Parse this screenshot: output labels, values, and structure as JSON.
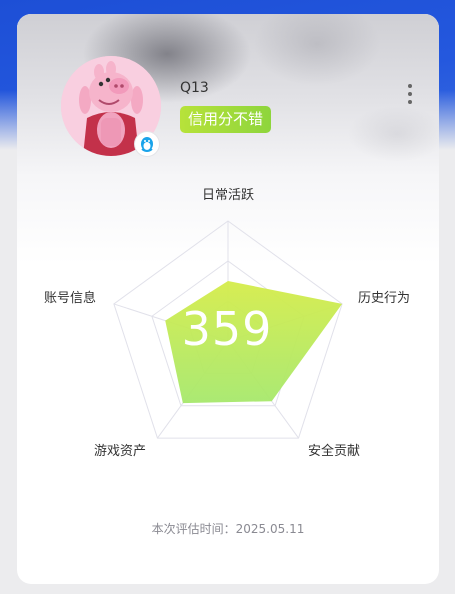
{
  "profile": {
    "username": "Q13",
    "credit_tag": "信用分不错",
    "avatar_icon": "peppa-pig-avatar",
    "badge_icon": "qq-penguin-icon"
  },
  "radar": {
    "score": "359",
    "axes": [
      "日常活跃",
      "历史行为",
      "安全贡献",
      "游戏资产",
      "账号信息"
    ],
    "values": [
      0.5,
      1.0,
      0.62,
      0.64,
      0.55
    ],
    "fill_color_top": "#d5ec4a",
    "fill_color_bottom": "#a6e86c"
  },
  "footer": {
    "eval_time": "本次评估时间：2025.05.11"
  },
  "colors": {
    "header_blue": "#1d4fd6",
    "tag_green": "#9bd93b"
  }
}
